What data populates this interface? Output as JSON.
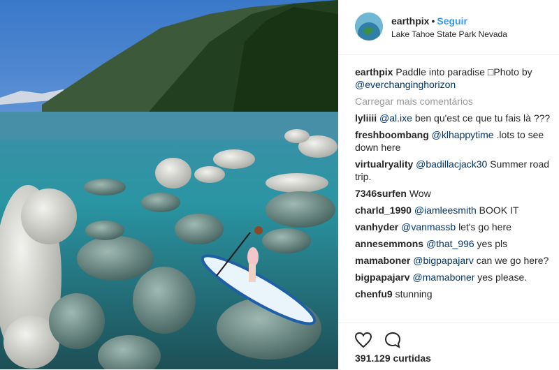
{
  "post": {
    "username": "earthpix",
    "separator": "•",
    "follow_label": "Seguir",
    "location": "Lake Tahoe State Park Nevada"
  },
  "caption": {
    "username": "earthpix",
    "text": "Paddle into paradise □Photo by",
    "mention": "@everchanginghorizon"
  },
  "load_more_label": "Carregar mais comentários",
  "comments": [
    {
      "user": "lyliiii",
      "mention": "@al.ixe",
      "text": "ben qu'est ce que tu fais là ???"
    },
    {
      "user": "freshboombang",
      "mention": "@klhappytime",
      "text": ".lots to see down here"
    },
    {
      "user": "virtualryality",
      "mention": "@badillacjack30",
      "text": "Summer road trip."
    },
    {
      "user": "7346surfen",
      "mention": "",
      "text": "Wow"
    },
    {
      "user": "charld_1990",
      "mention": "@iamleesmith",
      "text": "BOOK IT"
    },
    {
      "user": "vanhyder",
      "mention": "@vanmassb",
      "text": "let's go here"
    },
    {
      "user": "annesemmons",
      "mention": "@that_996",
      "text": "yes pls"
    },
    {
      "user": "mamaboner",
      "mention": "@bigpapajarv",
      "text": "can we go here?"
    },
    {
      "user": "bigpapajarv",
      "mention": "@mamaboner",
      "text": "yes please."
    },
    {
      "user": "chenfu9",
      "mention": "",
      "text": "stunning"
    }
  ],
  "likes": "391.129 curtidas",
  "icons": {
    "like": "heart-icon",
    "comment": "comment-icon"
  },
  "colors": {
    "link": "#3897f0",
    "mention": "#003569",
    "muted": "#999999"
  }
}
